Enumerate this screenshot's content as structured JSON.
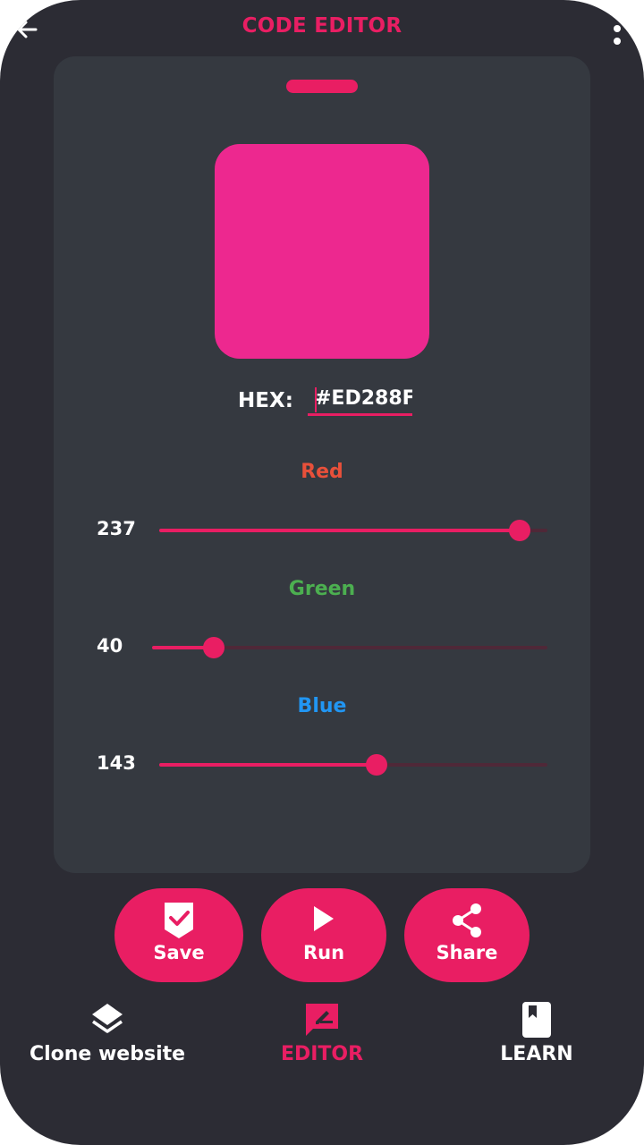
{
  "header": {
    "title": "CODE EDITOR",
    "back_icon": "back-arrow-icon",
    "menu_icon": "more-vert-icon"
  },
  "colors": {
    "accent": "#e91e63",
    "card": "#353940",
    "background": "#2c2c34",
    "red_label": "#e8503a",
    "green_label": "#4caf50",
    "blue_label": "#2196f3"
  },
  "picker": {
    "swatch_color": "#ED288F",
    "hex_label": "HEX:",
    "hex_value": "#ED288F",
    "channels": {
      "red": {
        "label": "Red",
        "value": "237",
        "fraction": 0.929
      },
      "green": {
        "label": "Green",
        "value": "40",
        "fraction": 0.157
      },
      "blue": {
        "label": "Blue",
        "value": "143",
        "fraction": 0.561
      }
    }
  },
  "actions": {
    "save": {
      "label": "Save",
      "icon": "save-check-icon"
    },
    "run": {
      "label": "Run",
      "icon": "play-icon"
    },
    "share": {
      "label": "Share",
      "icon": "share-icon"
    }
  },
  "nav": {
    "clone": {
      "label": "Clone website",
      "icon": "layers-icon"
    },
    "editor": {
      "label": "EDITOR",
      "icon": "edit-message-icon"
    },
    "learn": {
      "label": "LEARN",
      "icon": "book-icon"
    }
  }
}
